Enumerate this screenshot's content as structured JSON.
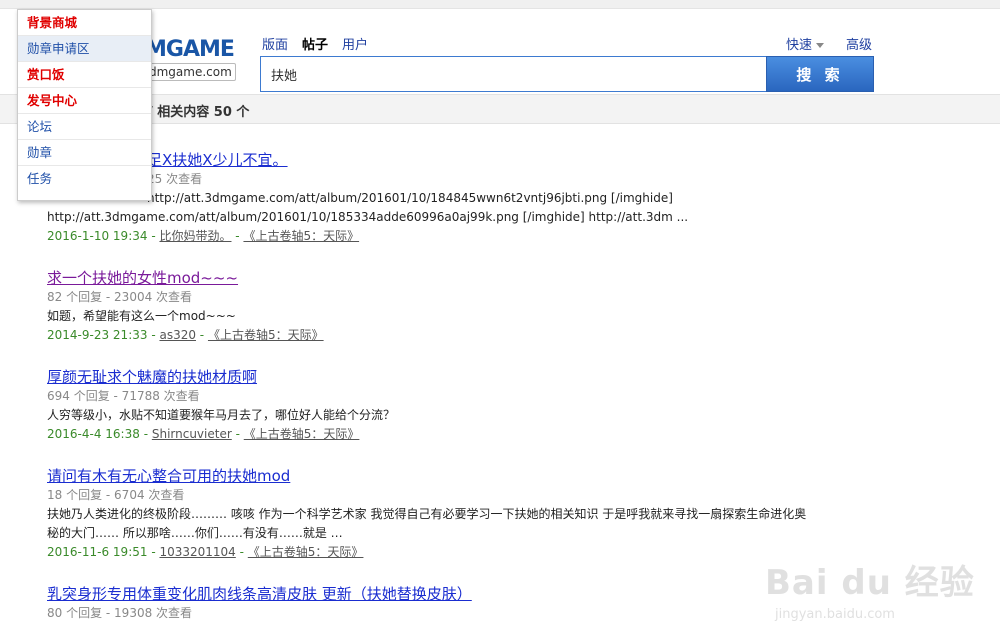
{
  "logo": {
    "text": "MGAME",
    "url": "dmgame.com"
  },
  "tabs": [
    {
      "label": "版面"
    },
    {
      "label": "帖子"
    },
    {
      "label": "用户"
    }
  ],
  "quick_label": "快速",
  "advanced_label": "高级",
  "search": {
    "value": "扶她",
    "button_label": "搜 索"
  },
  "results_summary": "/ 相关内容 50 个",
  "menu": [
    {
      "label": "背景商城"
    },
    {
      "label": "勋章申请区"
    },
    {
      "label": "赏口饭"
    },
    {
      "label": "发号中心"
    },
    {
      "label": "论坛"
    },
    {
      "label": "勋章"
    },
    {
      "label": "任务"
    }
  ],
  "results": [
    {
      "title": "足X扶她X少儿不宜。",
      "meta": "25 次查看",
      "snippet": "http://att.3dmgame.com/att/album/201601/10/184845wwn6t2vntj96jbti.png [/imghide]",
      "snippet2": "http://att.3dmgame.com/att/album/201601/10/185334adde60996a0aj99k.png [/imghide] http://att.3dm ...",
      "date": "2016-1-10 19:34",
      "user": "比你妈带劲。",
      "forum": "《上古卷轴5：天际》"
    },
    {
      "title": "求一个扶她的女性mod~~~",
      "meta": "82 个回复 - 23004 次查看",
      "snippet": "如题，希望能有这么一个mod~~~",
      "date": "2014-9-23 21:33",
      "user": "as320",
      "forum": "《上古卷轴5：天际》"
    },
    {
      "title": "厚颜无耻求个魅魔的扶她材质啊",
      "meta": "694 个回复 - 71788 次查看",
      "snippet": "人穷等级小，水贴不知道要猴年马月去了，哪位好人能给个分流？",
      "date": "2016-4-4 16:38",
      "user": "Shirncuvieter",
      "forum": "《上古卷轴5：天际》"
    },
    {
      "title": "请问有木有无心整合可用的扶她mod",
      "meta": "18 个回复 - 6704 次查看",
      "snippet": "扶她乃人类进化的终极阶段……… 咳咳 作为一个科学艺术家 我觉得自己有必要学习一下扶她的相关知识 于是呼我就来寻找一扇探索生命进化奥",
      "snippet2": "秘的大门…… 所以那啥……你们……有没有……就是 …",
      "date": "2016-11-6 19:51",
      "user": "1033201104",
      "forum": "《上古卷轴5：天际》"
    },
    {
      "title": "乳突身形专用体重变化肌肉线条高清皮肤 更新（扶她替换皮肤）",
      "meta": "80 个回复 - 19308 次查看"
    }
  ],
  "watermark": {
    "text": "Bai du 经验",
    "sub": "jingyan.baidu.com"
  },
  "colors": {
    "link": "#1a2dd0",
    "visited": "#7a1a9a",
    "date_green": "#3a8a2a",
    "menu_red": "#e00000",
    "search_blue": "#2a66bf"
  }
}
